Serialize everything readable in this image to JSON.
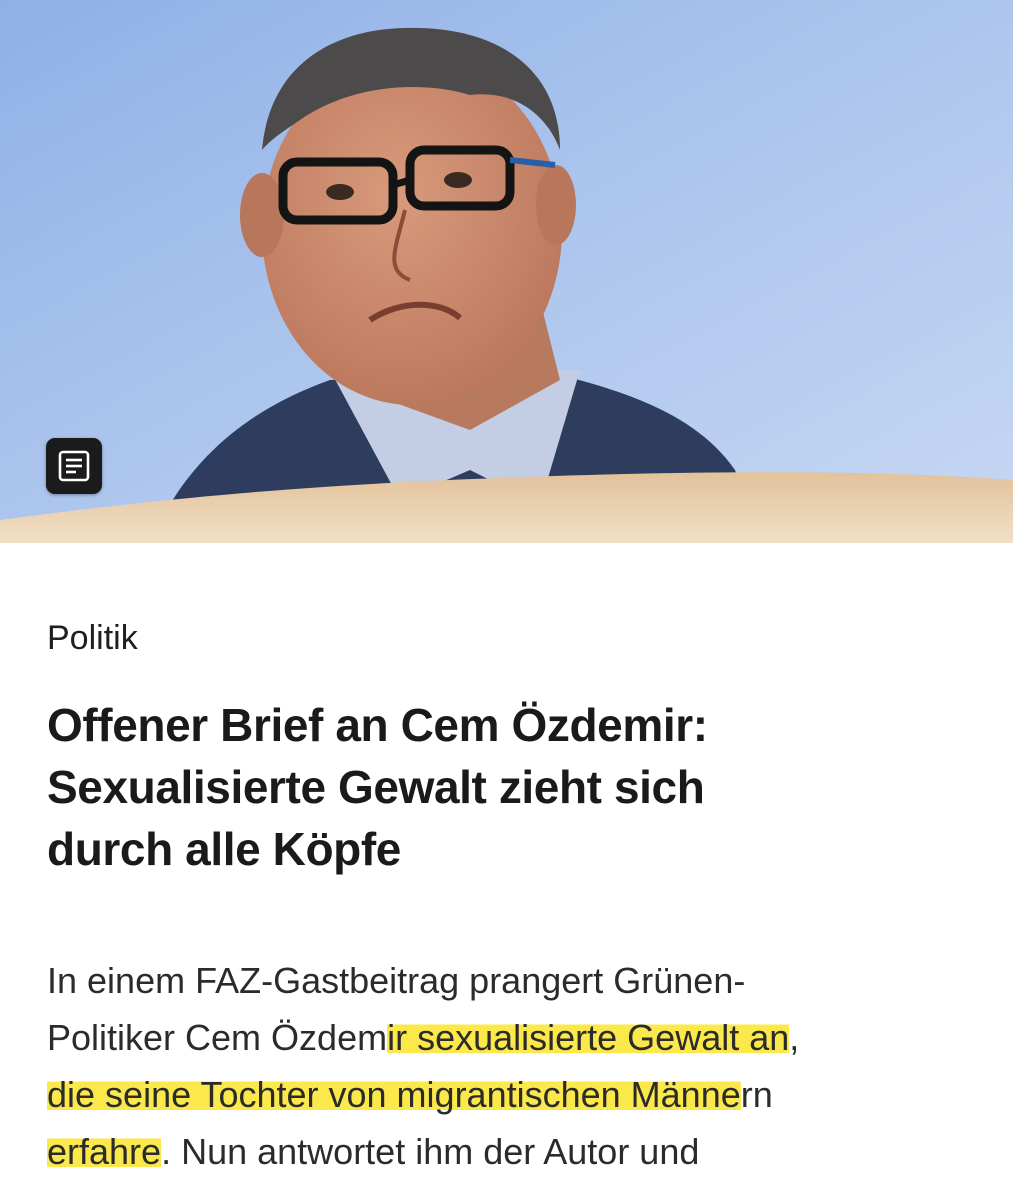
{
  "article": {
    "category": "Politik",
    "headline_lines": [
      "Offener Brief an Cem Özdemir:",
      "Sexualisierte Gewalt zieht sich",
      "durch alle Köpfe"
    ],
    "teaser": {
      "line1": "In einem FAZ-Gastbeitrag prangert Grünen-",
      "line2_plain": "Politiker Cem Özdem",
      "line2_hl": "ir sexualisierte Gewalt an",
      "line2_end": ",",
      "line3_hl": "die seine Tochter von migrantischen Männe",
      "line3_end": "rn",
      "line4_hl": "erfahre",
      "line4_end": ". Nun antwortet ihm der Autor und"
    }
  },
  "hero": {
    "description_icon": "article-document-icon",
    "background_color": "#a9c3ec",
    "highlight_color": "#fbe84a"
  }
}
